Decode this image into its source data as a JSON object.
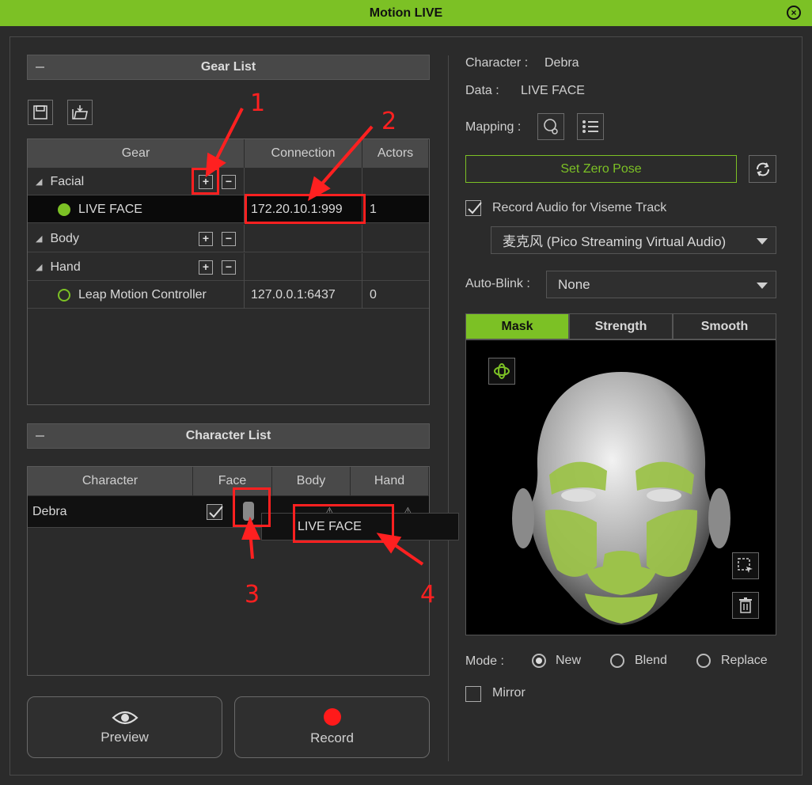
{
  "window": {
    "title": "Motion LIVE"
  },
  "gear_list": {
    "header": "Gear List",
    "columns": [
      "Gear",
      "Connection",
      "Actors"
    ],
    "rows": [
      {
        "type": "group",
        "label": "Facial"
      },
      {
        "type": "device",
        "label": "LIVE FACE",
        "connection": "172.20.10.1:999",
        "actors": "1",
        "status": "connected"
      },
      {
        "type": "group",
        "label": "Body"
      },
      {
        "type": "group",
        "label": "Hand"
      },
      {
        "type": "device",
        "label": "Leap Motion Controller",
        "connection": "127.0.0.1:6437",
        "actors": "0",
        "status": "disconnected"
      }
    ]
  },
  "character_list": {
    "header": "Character List",
    "columns": [
      "Character",
      "Face",
      "Body",
      "Hand"
    ],
    "rows": [
      {
        "character": "Debra"
      }
    ],
    "face_dropdown_option": "LIVE FACE"
  },
  "buttons": {
    "preview": "Preview",
    "record": "Record"
  },
  "right_panel": {
    "character_label": "Character :",
    "character_value": "Debra",
    "data_label": "Data :",
    "data_value": "LIVE FACE",
    "mapping_label": "Mapping :",
    "set_zero_pose": "Set Zero Pose",
    "record_audio_label": "Record Audio for Viseme Track",
    "record_audio_checked": true,
    "audio_device": "麦克风 (Pico Streaming Virtual Audio)",
    "auto_blink_label": "Auto-Blink :",
    "auto_blink_value": "None",
    "tabs": [
      "Mask",
      "Strength",
      "Smooth"
    ],
    "active_tab": "Mask",
    "mode_label": "Mode :",
    "modes": [
      "New",
      "Blend",
      "Replace"
    ],
    "selected_mode": "New",
    "mirror_label": "Mirror"
  },
  "annotations": [
    "1",
    "2",
    "3",
    "4"
  ],
  "colors": {
    "accent": "#7cc125",
    "annotation": "#ff2020",
    "record": "#ff1a1a"
  }
}
